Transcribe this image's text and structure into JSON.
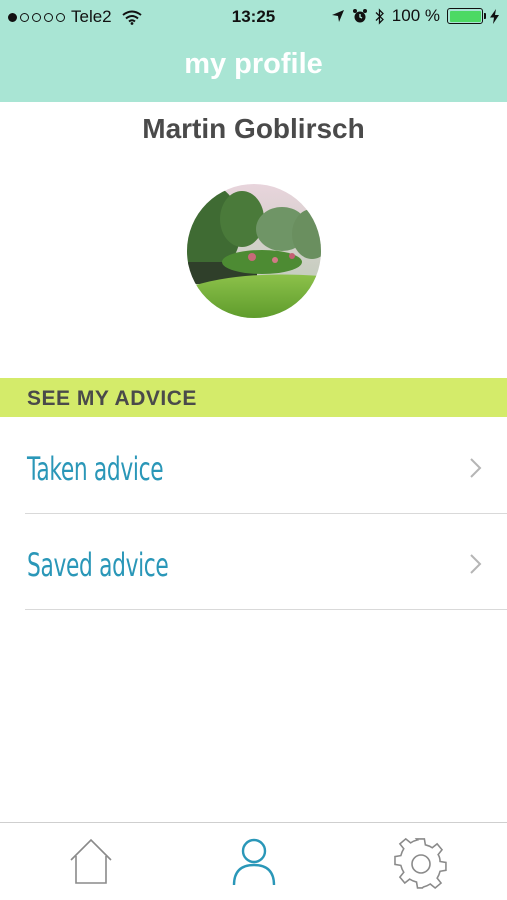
{
  "status_bar": {
    "carrier": "Tele2",
    "time": "13:25",
    "battery": "100 %",
    "signal_bars_filled": 1,
    "signal_bars_total": 5
  },
  "header": {
    "title": "my profile",
    "background": "#a9e5d4"
  },
  "profile": {
    "name": "Martin Goblirsch"
  },
  "advice_section": {
    "title": "SEE MY ADVICE",
    "background": "#d4eb6a",
    "items": [
      {
        "label": "Taken advice",
        "icon": "chevron-right-icon"
      },
      {
        "label": "Saved advice",
        "icon": "chevron-right-icon"
      }
    ]
  },
  "tab_bar": {
    "tabs": [
      {
        "icon": "home-icon",
        "active": false
      },
      {
        "icon": "profile-icon",
        "active": true
      },
      {
        "icon": "settings-gear-icon",
        "active": false
      }
    ],
    "active_color": "#2a97b8",
    "inactive_color": "#8a8a8a"
  }
}
